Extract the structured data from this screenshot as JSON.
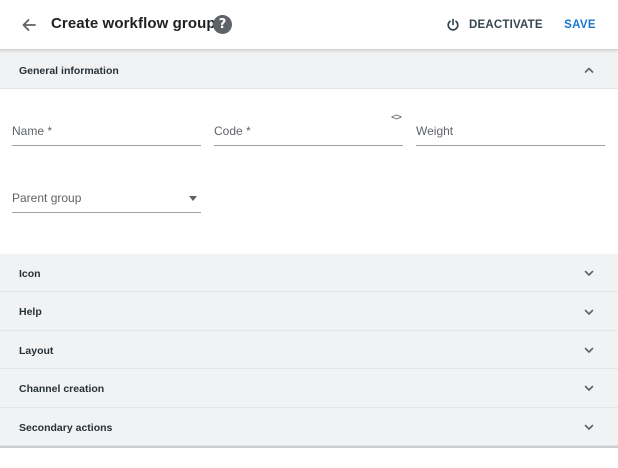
{
  "header": {
    "title": "Create workflow group",
    "help_icon_glyph": "?",
    "deactivate_label": "DEACTIVATE",
    "save_label": "SAVE"
  },
  "sections": {
    "general": {
      "label": "General information",
      "expanded": true
    },
    "icon": {
      "label": "Icon",
      "expanded": false
    },
    "help": {
      "label": "Help",
      "expanded": false
    },
    "layout": {
      "label": "Layout",
      "expanded": false
    },
    "channel_creation": {
      "label": "Channel creation",
      "expanded": false
    },
    "secondary_actions": {
      "label": "Secondary actions",
      "expanded": false
    }
  },
  "form": {
    "name": {
      "placeholder": "Name *",
      "value": ""
    },
    "code": {
      "placeholder": "Code *",
      "value": "",
      "icon_glyph": "<>"
    },
    "weight": {
      "placeholder": "Weight",
      "value": ""
    },
    "parent_group": {
      "placeholder": "Parent group",
      "value": ""
    }
  },
  "colors": {
    "accent": "#1976d2",
    "section_bg": "#f1f2f4",
    "text_dark": "#202124",
    "icon_gray": "#5f6368"
  },
  "icons": {
    "back": "arrow-left-icon",
    "help": "help-circle-icon",
    "deactivate": "power-icon",
    "code": "code-icon",
    "collapse": "chevron-up-icon",
    "expand": "chevron-down-icon",
    "dropdown": "caret-down-icon"
  }
}
